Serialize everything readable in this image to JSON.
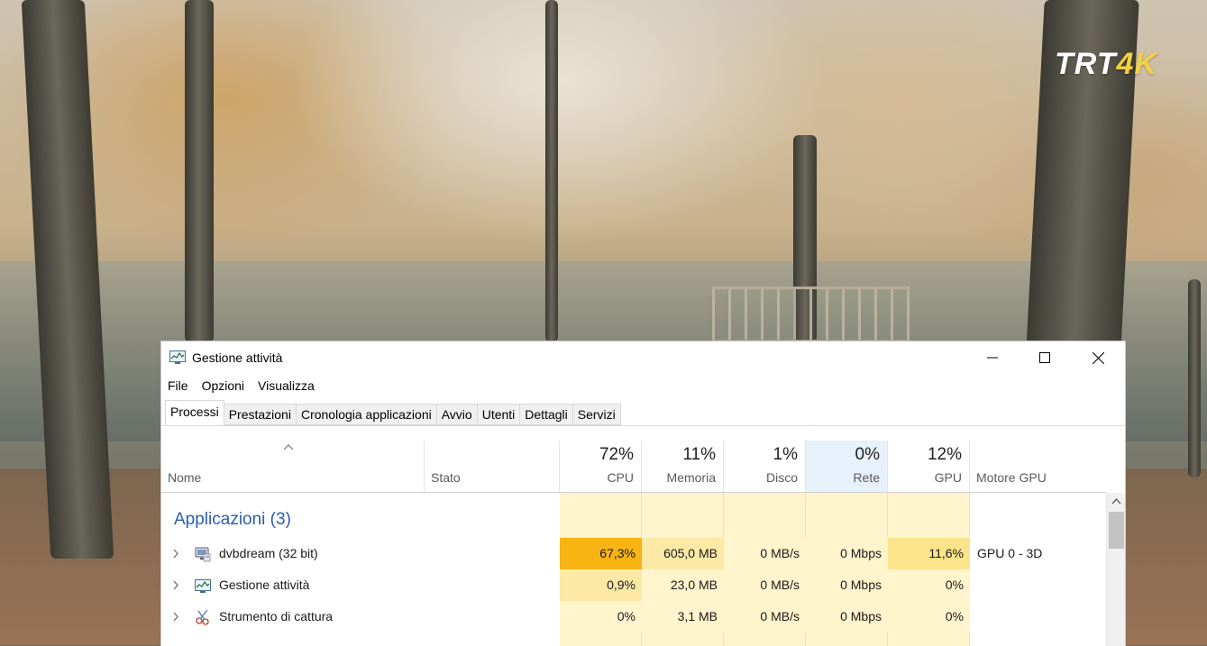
{
  "wallpaper": {
    "logo_main": "TRT",
    "logo_suffix": "4K"
  },
  "window": {
    "title": "Gestione attività",
    "icon": "task-manager-icon",
    "controls": [
      "minimize-icon",
      "maximize-icon",
      "close-icon"
    ]
  },
  "menu": [
    "File",
    "Opzioni",
    "Visualizza"
  ],
  "tabs": [
    {
      "label": "Processi",
      "active": true
    },
    {
      "label": "Prestazioni",
      "active": false
    },
    {
      "label": "Cronologia applicazioni",
      "active": false
    },
    {
      "label": "Avvio",
      "active": false
    },
    {
      "label": "Utenti",
      "active": false
    },
    {
      "label": "Dettagli",
      "active": false
    },
    {
      "label": "Servizi",
      "active": false
    }
  ],
  "columns": {
    "name": {
      "label": "Nome"
    },
    "status": {
      "label": "Stato"
    },
    "cpu": {
      "label": "CPU",
      "usage": "72%"
    },
    "memory": {
      "label": "Memoria",
      "usage": "11%"
    },
    "disk": {
      "label": "Disco",
      "usage": "1%"
    },
    "network": {
      "label": "Rete",
      "usage": "0%"
    },
    "gpu": {
      "label": "GPU",
      "usage": "12%"
    },
    "gpu_engine": {
      "label": "Motore GPU"
    }
  },
  "group": {
    "label": "Applicazioni (3)"
  },
  "rows": [
    {
      "name": "dvbdream (32 bit)",
      "icon": "dvbdream-icon",
      "cpu": "67,3%",
      "memory": "605,0 MB",
      "disk": "0 MB/s",
      "network": "0 Mbps",
      "gpu": "11,6%",
      "gpu_engine": "GPU 0 - 3D"
    },
    {
      "name": "Gestione attività",
      "icon": "task-manager-icon",
      "cpu": "0,9%",
      "memory": "23,0 MB",
      "disk": "0 MB/s",
      "network": "0 Mbps",
      "gpu": "0%",
      "gpu_engine": ""
    },
    {
      "name": "Strumento di cattura",
      "icon": "snipping-tool-icon",
      "cpu": "0%",
      "memory": "3,1 MB",
      "disk": "0 MB/s",
      "network": "0 Mbps",
      "gpu": "0%",
      "gpu_engine": ""
    }
  ],
  "colors": {
    "cpu_high": "#f8b413",
    "heat_medium": "#fce9a6",
    "heat_low": "#fff4cc",
    "heat_faint": "#fff9e3",
    "network_header": "#e6f1fb",
    "group_title": "#2a5db0"
  }
}
